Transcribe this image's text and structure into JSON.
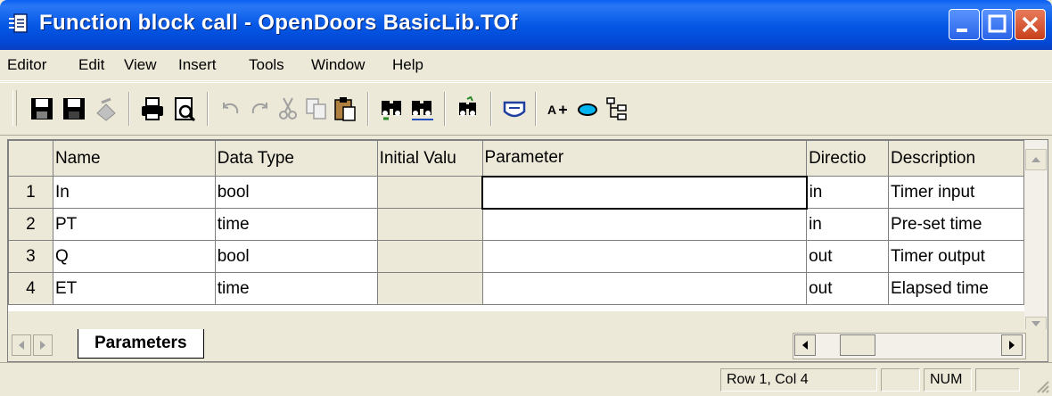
{
  "window": {
    "title": "Function block call - OpenDoors BasicLib.TOf"
  },
  "menu": [
    "Editor",
    "Edit",
    "View",
    "Insert",
    "Tools",
    "Window",
    "Help"
  ],
  "toolbar": [
    "save-icon",
    "save-all-icon",
    "compile-icon",
    "print-icon",
    "print-preview-icon",
    "undo-icon",
    "redo-icon",
    "cut-icon",
    "copy-icon",
    "paste-icon",
    "find-icon",
    "find-replace-icon",
    "search-library-icon",
    "properties-icon",
    "text-size-icon",
    "ellipse-icon",
    "tree-icon"
  ],
  "grid": {
    "headers": [
      "",
      "Name",
      "Data Type",
      "Initial Valu",
      "Parameter",
      "Directio",
      "Description"
    ],
    "rows": [
      {
        "num": "1",
        "name": "In",
        "type": "bool",
        "init": "",
        "param": "",
        "dir": "in",
        "desc": "Timer input"
      },
      {
        "num": "2",
        "name": "PT",
        "type": "time",
        "init": "",
        "param": "",
        "dir": "in",
        "desc": "Pre-set time"
      },
      {
        "num": "3",
        "name": "Q",
        "type": "bool",
        "init": "",
        "param": "",
        "dir": "out",
        "desc": "Timer output"
      },
      {
        "num": "4",
        "name": "ET",
        "type": "time",
        "init": "",
        "param": "",
        "dir": "out",
        "desc": "Elapsed time"
      }
    ]
  },
  "tabs": {
    "active": "Parameters"
  },
  "status": {
    "position": "Row 1, Col 4",
    "num": "NUM"
  },
  "colors": {
    "titlebar": "#0558e6",
    "face": "#ece9d8",
    "close": "#c8401c"
  }
}
